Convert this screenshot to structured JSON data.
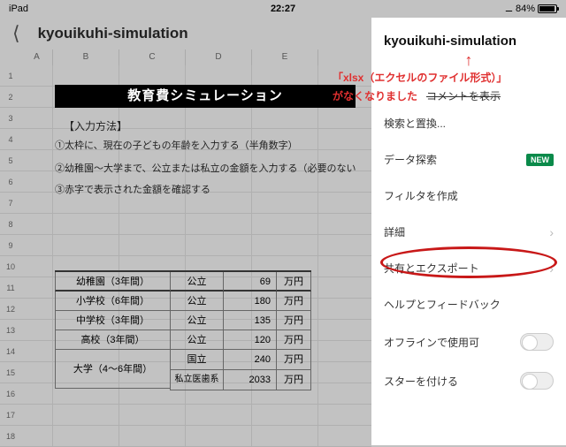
{
  "status": {
    "device": "iPad",
    "time": "22:27",
    "bt_icon": "✱",
    "battery_pct": "84%"
  },
  "header": {
    "title": "kyouikuhi-simulation"
  },
  "columns": [
    "A",
    "B",
    "C",
    "D",
    "E"
  ],
  "rows": [
    "1",
    "2",
    "3",
    "4",
    "5",
    "6",
    "7",
    "8",
    "9",
    "10",
    "11",
    "12",
    "13",
    "14",
    "15",
    "16",
    "17",
    "18"
  ],
  "sheet": {
    "title_band": "教育費シミュレーション",
    "input_method": "【入力方法】",
    "step1": "①太枠に、現在の子どもの年齢を入力する（半角数字）",
    "step2": "②幼稚園〜大学まで、公立または私立の金額を入力する（必要のない",
    "step3": "③赤字で表示された金額を確認する"
  },
  "table": {
    "rows": [
      {
        "label": "幼稚園（3年間）",
        "type": "公立",
        "amount": "69",
        "unit": "万円"
      },
      {
        "label": "小学校（6年間）",
        "type": "公立",
        "amount": "180",
        "unit": "万円"
      },
      {
        "label": "中学校（3年間）",
        "type": "公立",
        "amount": "135",
        "unit": "万円"
      },
      {
        "label": "高校（3年間）",
        "type": "公立",
        "amount": "120",
        "unit": "万円"
      },
      {
        "label": "大学（4〜6年間）",
        "type": "国立",
        "amount": "240",
        "unit": "万円",
        "span2": true
      },
      {
        "label": "",
        "type": "私立医歯系",
        "amount": "2033",
        "unit": "万円"
      }
    ]
  },
  "panel": {
    "title": "kyouikuhi-simulation",
    "annot1": "「xlsx（エクセルのファイル形式）」",
    "annot2": "がなくなりました",
    "items": {
      "show_comments_strike": "コメントを表示",
      "find_replace": "検索と置換...",
      "explore": "データ探索",
      "new_badge": "NEW",
      "create_filter": "フィルタを作成",
      "details": "詳細",
      "share_export": "共有とエクスポート",
      "help_feedback": "ヘルプとフィードバック",
      "offline": "オフラインで使用可",
      "star": "スターを付ける"
    }
  }
}
